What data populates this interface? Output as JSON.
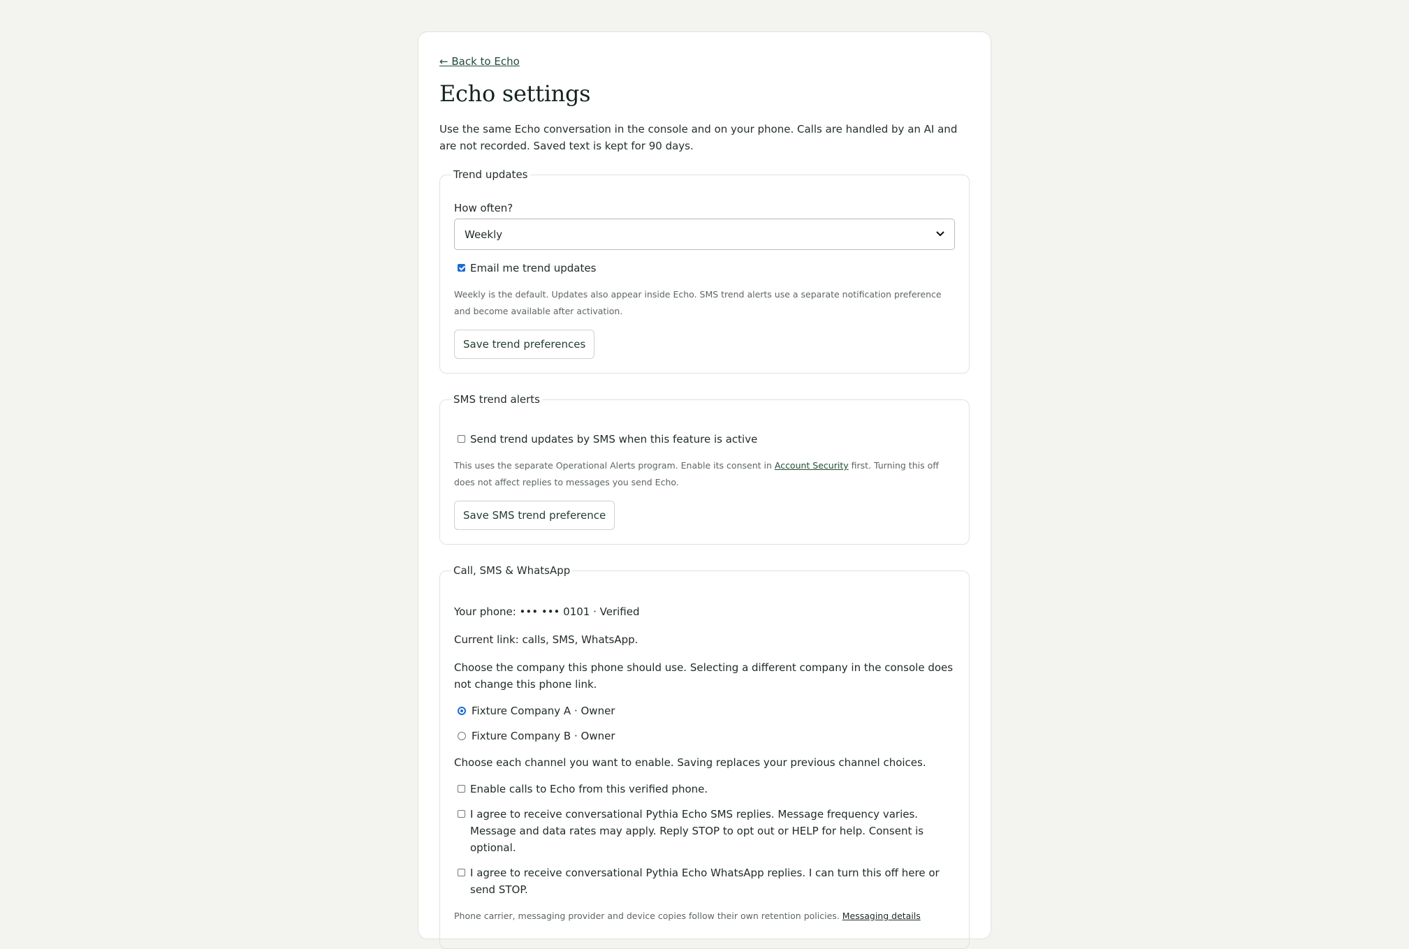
{
  "back_link": "← Back to Echo",
  "title": "Echo settings",
  "intro": "Use the same Echo conversation in the console and on your phone. Calls are handled by an AI and are not recorded. Saved text is kept for 90 days.",
  "trend": {
    "legend": "Trend updates",
    "how_often_label": "How often?",
    "frequency_value": "Weekly",
    "email_label": "Email me trend updates",
    "email_checked": true,
    "help": "Weekly is the default. Updates also appear inside Echo. SMS trend alerts use a separate notification preference and become available after activation.",
    "save_label": "Save trend preferences"
  },
  "sms": {
    "legend": "SMS trend alerts",
    "checkbox_label": "Send trend updates by SMS when this feature is active",
    "checked": false,
    "help_before": "This uses the separate Operational Alerts program. Enable its consent in ",
    "help_link": "Account Security",
    "help_after": " first. Turning this off does not affect replies to messages you send Echo.",
    "save_label": "Save SMS trend preference"
  },
  "channels": {
    "legend": "Call, SMS & WhatsApp",
    "phone_line": "Your phone: ••• ••• 0101 · Verified",
    "current_link": "Current link: calls, SMS, WhatsApp.",
    "company_prompt": "Choose the company this phone should use. Selecting a different company in the console does not change this phone link.",
    "companies": [
      {
        "label": "Fixture Company A · Owner",
        "selected": true
      },
      {
        "label": "Fixture Company B · Owner",
        "selected": false
      }
    ],
    "channel_prompt": "Choose each channel you want to enable. Saving replaces your previous channel choices.",
    "calls_label": "Enable calls to Echo from this verified phone.",
    "sms_consent": "I agree to receive conversational Pythia Echo SMS replies. Message frequency varies. Message and data rates may apply. Reply STOP to opt out or HELP for help. Consent is optional.",
    "whatsapp_consent": "I agree to receive conversational Pythia Echo WhatsApp replies. I can turn this off here or send STOP.",
    "footer_note": "Phone carrier, messaging provider and device copies follow their own retention policies.",
    "footer_link": "Messaging details"
  }
}
